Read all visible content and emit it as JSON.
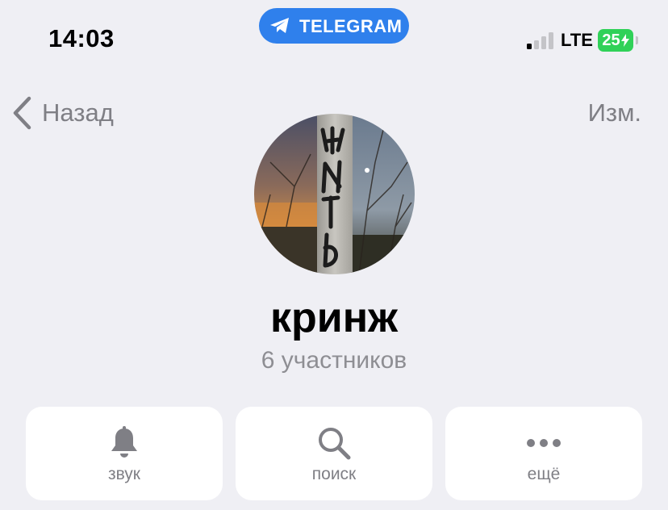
{
  "status_bar": {
    "time": "14:03",
    "banner_label": "TELEGRAM",
    "network": "LTE",
    "battery": "25",
    "signal_bars_active": 1
  },
  "nav": {
    "back_label": "Назад",
    "edit_label": "Изм."
  },
  "profile": {
    "title": "кринж",
    "subtitle": "6 участников"
  },
  "actions": [
    {
      "label": "звук",
      "icon": "bell-icon"
    },
    {
      "label": "поиск",
      "icon": "search-icon"
    },
    {
      "label": "ещё",
      "icon": "more-icon"
    }
  ],
  "colors": {
    "accent": "#2f80ec",
    "background": "#efeff4",
    "secondary_text": "#7f7f85",
    "battery_green": "#30d158"
  }
}
